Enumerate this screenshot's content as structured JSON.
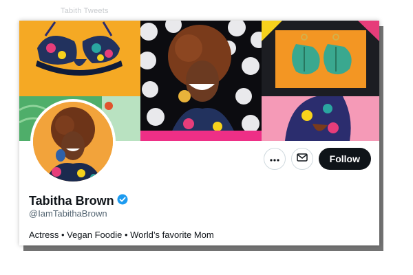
{
  "top": {
    "faded_text": "Tabith Tweets"
  },
  "profile": {
    "name": "Tabitha Brown",
    "handle": "@IamTabithaBrown",
    "bio": "Actress • Vegan Foodie • World’s favorite Mom",
    "verified": true
  },
  "actions": {
    "more_icon": "more-icon",
    "message_icon": "mail-icon",
    "follow_label": "Follow"
  },
  "colors": {
    "verified_blue": "#1d9bf0",
    "follow_bg": "#0f1419",
    "handle_gray": "#536471",
    "banner_pink": "#ef3f86",
    "banner_orange": "#f4a52c"
  }
}
